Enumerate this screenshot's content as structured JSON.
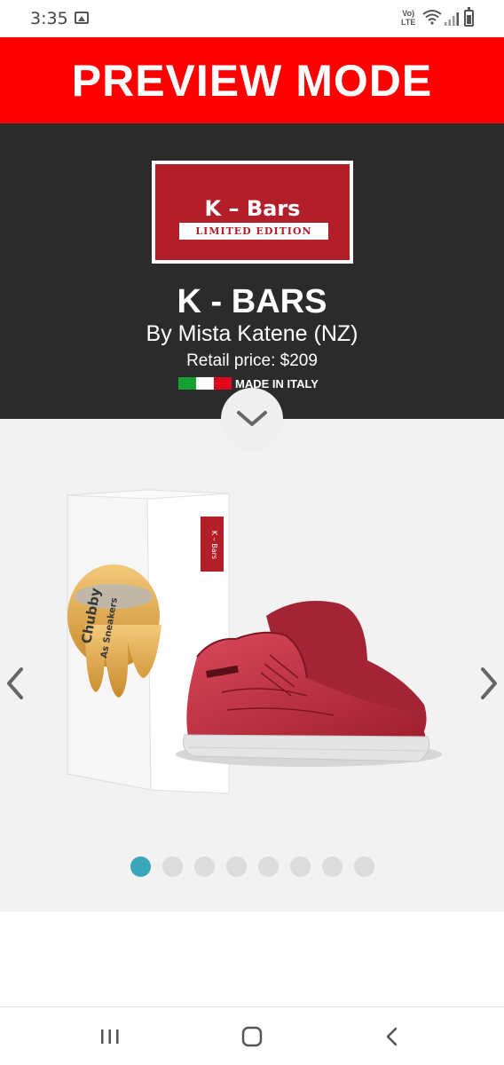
{
  "status_bar": {
    "time": "3:35",
    "network_label_top": "Vo)",
    "network_label_bottom": "LTE",
    "icons": [
      "image-icon",
      "wifi-icon",
      "signal-icon",
      "battery-icon"
    ]
  },
  "banner": {
    "text": "PREVIEW MODE",
    "color": "#ff0000"
  },
  "product": {
    "logo_title": "K – Bars",
    "logo_subtitle": "LIMITED EDITION",
    "logo_color": "#b21f29",
    "title": "K - BARS",
    "byline": "By Mista Katene (NZ)",
    "price": "Retail price: $209",
    "made_in": "MADE IN ITALY",
    "flag_colors": [
      "#15a12f",
      "#ffffff",
      "#e1061b"
    ]
  },
  "gallery": {
    "box_brand_text": "Chubby",
    "box_sub_text": "As Sneakers",
    "box_label_text": "K – Bars",
    "slide_count": 8,
    "active_slide": 1,
    "active_color": "#3aa6b9",
    "inactive_color": "#dcdcdc"
  },
  "nav_bar": {
    "icons": [
      "recent-apps-icon",
      "home-icon",
      "back-icon"
    ]
  }
}
